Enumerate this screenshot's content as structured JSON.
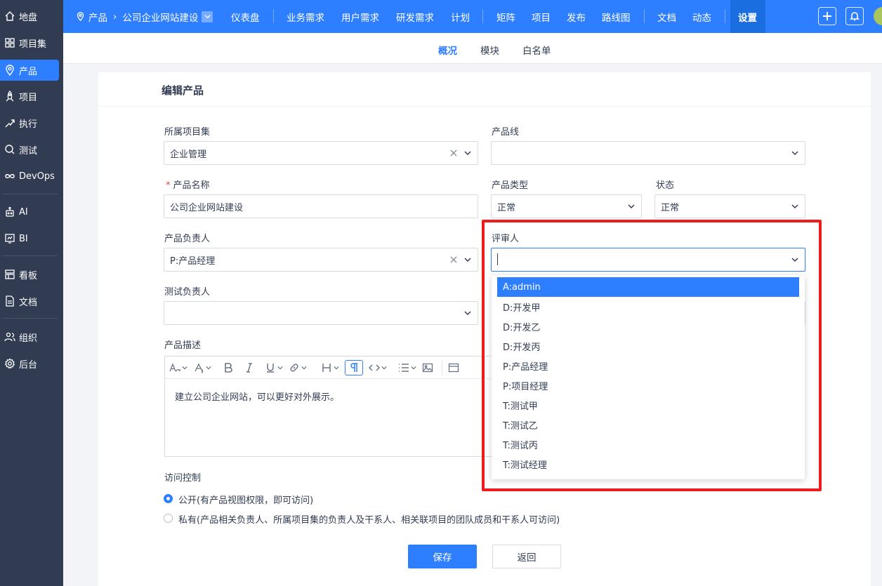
{
  "sidebar": {
    "items": [
      {
        "label": "地盘",
        "icon": "home-icon"
      },
      {
        "label": "项目集",
        "icon": "grid-icon"
      },
      {
        "label": "产品",
        "icon": "location-pin-icon"
      },
      {
        "label": "项目",
        "icon": "rocket-icon"
      },
      {
        "label": "执行",
        "icon": "run-icon"
      },
      {
        "label": "测试",
        "icon": "search-check-icon"
      },
      {
        "label": "DevOps",
        "icon": "infinity-icon"
      },
      {
        "label": "AI",
        "icon": "robot-icon"
      },
      {
        "label": "BI",
        "icon": "chart-icon"
      },
      {
        "label": "看板",
        "icon": "kanban-icon"
      },
      {
        "label": "文档",
        "icon": "document-icon"
      },
      {
        "label": "组织",
        "icon": "people-icon"
      },
      {
        "label": "后台",
        "icon": "gear-icon"
      }
    ],
    "active": "产品"
  },
  "topbar": {
    "breadcrumb_root": "产品",
    "breadcrumb_current": "公司企业网站建设",
    "nav": [
      "仪表盘",
      "业务需求",
      "用户需求",
      "研发需求",
      "计划",
      "矩阵",
      "项目",
      "发布",
      "路线图",
      "文档",
      "动态",
      "设置"
    ],
    "active_nav": "设置"
  },
  "subnav": {
    "items": [
      "概况",
      "模块",
      "白名单"
    ],
    "active": "概况"
  },
  "form": {
    "title": "编辑产品",
    "program_label": "所属项目集",
    "program_value": "企业管理",
    "line_label": "产品线",
    "line_value": "",
    "name_label": "产品名称",
    "name_required": "*",
    "name_value": "公司企业网站建设",
    "type_label": "产品类型",
    "type_value": "正常",
    "status_label": "状态",
    "status_value": "正常",
    "po_label": "产品负责人",
    "po_value": "P:产品经理",
    "reviewer_label": "评审人",
    "reviewer_value": "",
    "qd_label": "测试负责人",
    "qd_value": "",
    "desc_label": "产品描述",
    "desc_value": "建立公司企业网站，可以更好对外展示。",
    "acl_label": "访问控制",
    "acl_open": "公开(有产品视图权限，即可访问)",
    "acl_private": "私有(产品相关负责人、所属项目集的负责人及干系人、相关联项目的团队成员和干系人可访问)",
    "acl_selected": "open",
    "save_label": "保存",
    "back_label": "返回"
  },
  "dropdown": {
    "options": [
      "A:admin",
      "D:开发甲",
      "D:开发乙",
      "D:开发丙",
      "P:产品经理",
      "P:项目经理",
      "T:测试甲",
      "T:测试乙",
      "T:测试丙",
      "T:测试经理"
    ],
    "highlighted": "A:admin"
  },
  "colors": {
    "primary": "#2e7fff",
    "sidebar": "#313c52",
    "annotation": "#ee1c1c"
  }
}
